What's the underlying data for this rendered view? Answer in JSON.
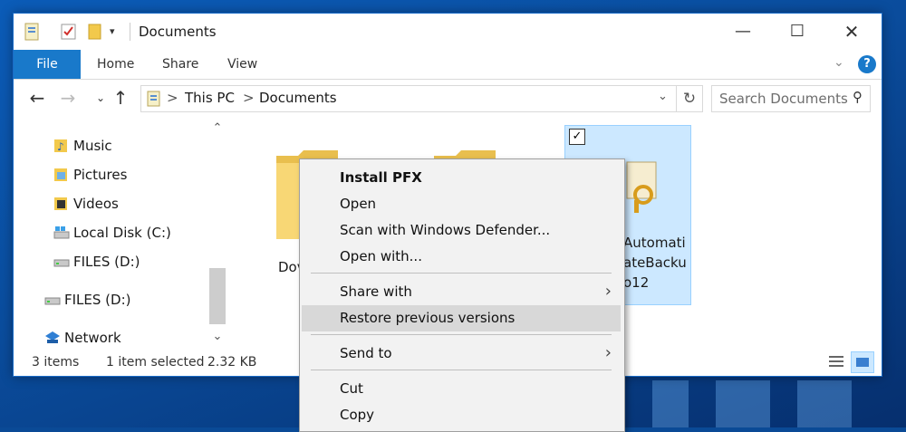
{
  "window": {
    "title": "Documents"
  },
  "ribbon": {
    "file": "File",
    "home": "Home",
    "share": "Share",
    "view": "View"
  },
  "address": {
    "this_pc": "This PC",
    "documents": "Documents",
    "sep": ">"
  },
  "search": {
    "placeholder": "Search Documents"
  },
  "nav": {
    "items": [
      {
        "label": "Music",
        "icon": "music-icon"
      },
      {
        "label": "Pictures",
        "icon": "pictures-icon"
      },
      {
        "label": "Videos",
        "icon": "videos-icon"
      },
      {
        "label": "Local Disk (C:)",
        "icon": "local-disk-icon"
      },
      {
        "label": "FILES (D:)",
        "icon": "drive-icon"
      },
      {
        "label": "FILES (D:)",
        "icon": "drive-icon"
      },
      {
        "label": "Network",
        "icon": "network-icon"
      }
    ]
  },
  "content": {
    "folder1_label": "Dov",
    "selected_label_l1": "Automati",
    "selected_label_l2": "ateBacku",
    "selected_label_l3": "o12"
  },
  "status": {
    "items": "3 items",
    "selected": "1 item selected",
    "size": "2.32 KB"
  },
  "context_menu": {
    "items": [
      {
        "label": "Install PFX",
        "bold": true
      },
      {
        "label": "Open"
      },
      {
        "label": "Scan with Windows Defender..."
      },
      {
        "label": "Open with..."
      },
      {
        "label": "Share with",
        "submenu": true
      },
      {
        "label": "Restore previous versions",
        "highlighted": true
      },
      {
        "label": "Send to",
        "submenu": true
      },
      {
        "label": "Cut"
      },
      {
        "label": "Copy"
      }
    ]
  },
  "colors": {
    "accent": "#1979ca",
    "selection": "#cce8ff",
    "folder": "#f8d775"
  }
}
